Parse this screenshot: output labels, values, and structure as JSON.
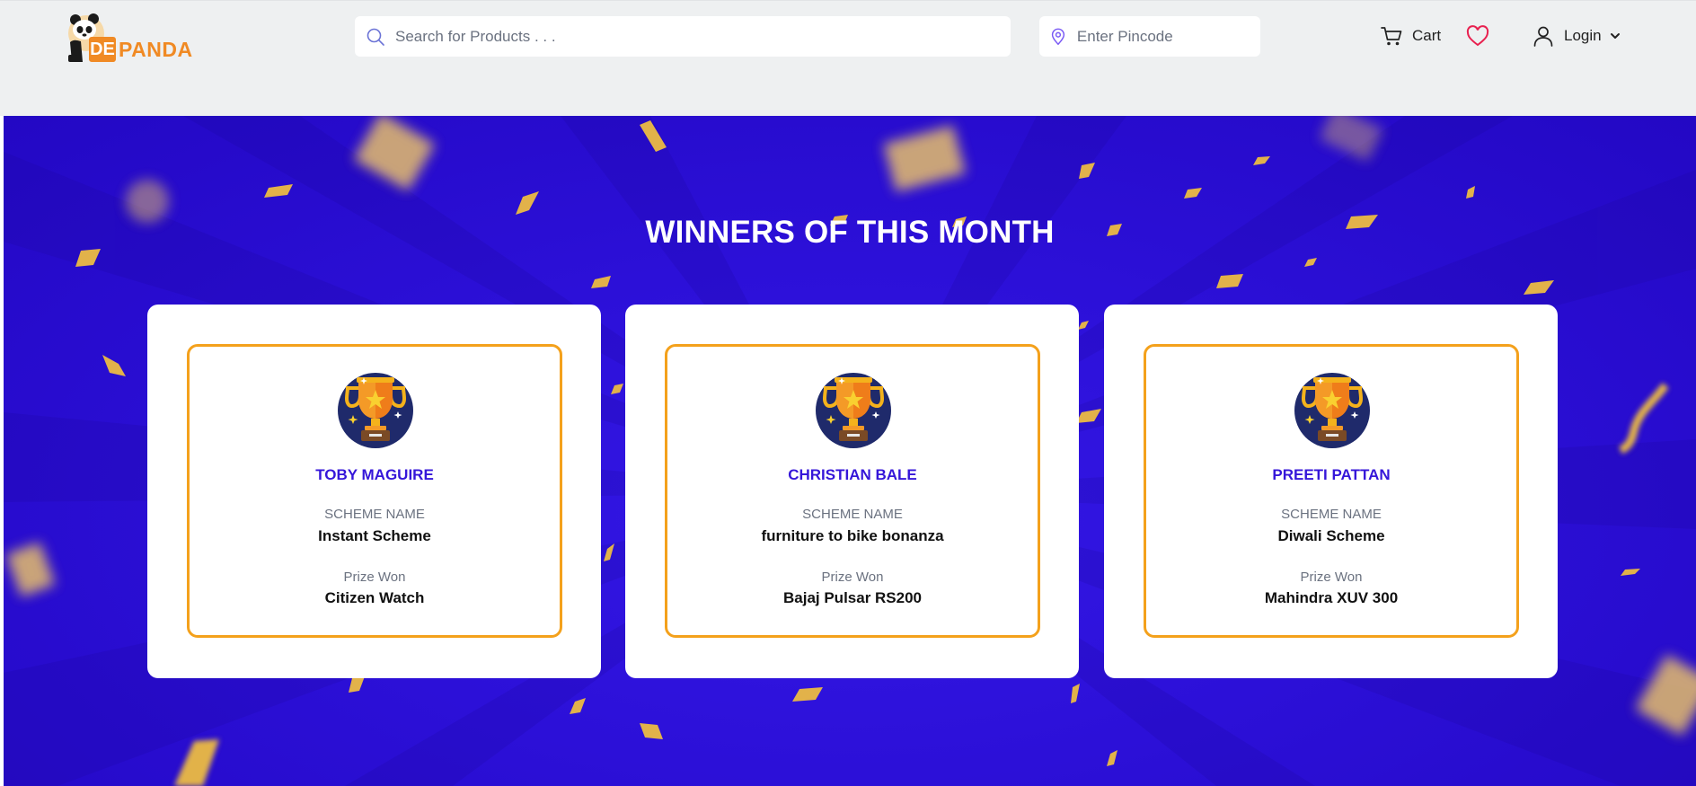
{
  "header": {
    "logo": {
      "prefix": "DE",
      "name": "PANDA"
    },
    "search": {
      "placeholder": "Search for Products . . .",
      "icon": "search-icon"
    },
    "pincode": {
      "placeholder": "Enter Pincode",
      "icon": "location-pin-icon"
    },
    "cart_label": "Cart",
    "login_label": "Login"
  },
  "banner": {
    "title": "WINNERS OF THIS MONTH"
  },
  "winners": [
    {
      "name": "TOBY MAGUIRE",
      "scheme_label": "SCHEME NAME",
      "scheme": "Instant Scheme",
      "prize_label": "Prize Won",
      "prize": "Citizen Watch"
    },
    {
      "name": "CHRISTIAN BALE",
      "scheme_label": "SCHEME NAME",
      "scheme": "furniture to bike bonanza",
      "prize_label": "Prize Won",
      "prize": "Bajaj Pulsar RS200"
    },
    {
      "name": "PREETI PATTAN",
      "scheme_label": "SCHEME NAME",
      "scheme": "Diwali Scheme",
      "prize_label": "Prize Won",
      "prize": "Mahindra XUV 300"
    }
  ],
  "colors": {
    "brand_orange": "#f08a24",
    "banner_blue": "#2c10d8",
    "card_border": "#f4a11c",
    "winner_name": "#3516d9",
    "heart": "#e8204f"
  }
}
